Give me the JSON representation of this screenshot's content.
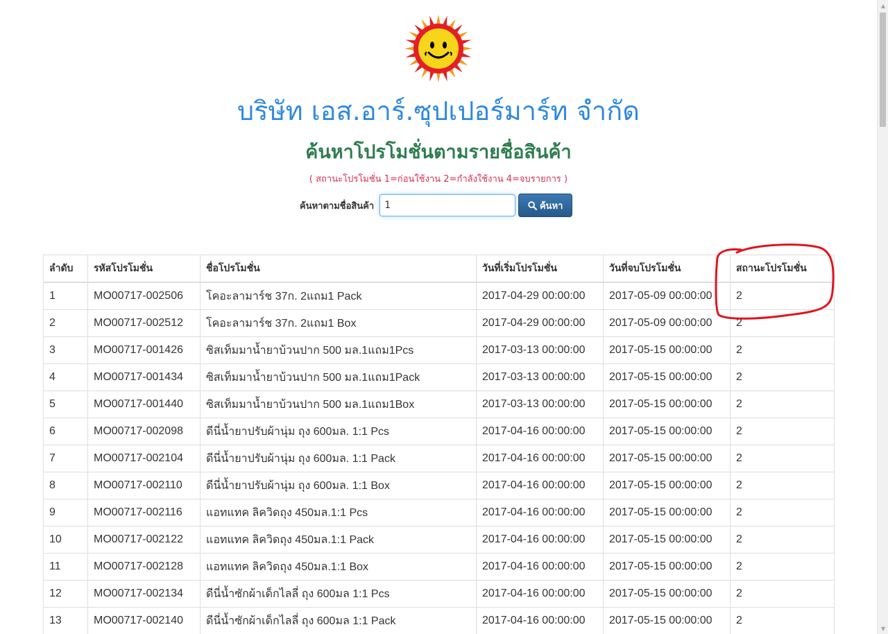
{
  "header": {
    "company_name": "บริษัท เอส.อาร์.ซุปเปอร์มาร์ท จำกัด",
    "page_title": "ค้นหาโปรโมชั่นตามรายชื่อสินค้า",
    "status_note": "( สถานะโปรโมชั่น 1=ก่อนใช้งาน 2=กำลังใช้งาน 4=จบรายการ )"
  },
  "search": {
    "label": "ค้นหาตามชื่อสินค้า",
    "value": "1",
    "button_label": "ค้นหา"
  },
  "table": {
    "columns": [
      "ลำดับ",
      "รหัสโปรโมชั่น",
      "ชื่อโปรโมชั่น",
      "วันที่เริ่มโปรโมชั่น",
      "วันที่จบโปรโมชั่น",
      "สถานะโปรโมชั่น"
    ],
    "rows": [
      [
        "1",
        "MO00717-002506",
        "โคอะลามาร์ช 37ก. 2แถม1 Pack",
        "2017-04-29 00:00:00",
        "2017-05-09 00:00:00",
        "2"
      ],
      [
        "2",
        "MO00717-002512",
        "โคอะลามาร์ช 37ก. 2แถม1 Box",
        "2017-04-29 00:00:00",
        "2017-05-09 00:00:00",
        "2"
      ],
      [
        "3",
        "MO00717-001426",
        "ซิสเท็มมาน้ำยาบ้วนปาก 500 มล.1แถม1Pcs",
        "2017-03-13 00:00:00",
        "2017-05-15 00:00:00",
        "2"
      ],
      [
        "4",
        "MO00717-001434",
        "ซิสเท็มมาน้ำยาบ้วนปาก 500 มล.1แถม1Pack",
        "2017-03-13 00:00:00",
        "2017-05-15 00:00:00",
        "2"
      ],
      [
        "5",
        "MO00717-001440",
        "ซิสเท็มมาน้ำยาบ้วนปาก 500 มล.1แถม1Box",
        "2017-03-13 00:00:00",
        "2017-05-15 00:00:00",
        "2"
      ],
      [
        "6",
        "MO00717-002098",
        "ดีนี่น้ำยาปรับผ้านุ่ม ถุง 600มล. 1:1 Pcs",
        "2017-04-16 00:00:00",
        "2017-05-15 00:00:00",
        "2"
      ],
      [
        "7",
        "MO00717-002104",
        "ดีนี่น้ำยาปรับผ้านุ่ม ถุง 600มล. 1:1 Pack",
        "2017-04-16 00:00:00",
        "2017-05-15 00:00:00",
        "2"
      ],
      [
        "8",
        "MO00717-002110",
        "ดีนี่น้ำยาปรับผ้านุ่ม ถุง 600มล. 1:1 Box",
        "2017-04-16 00:00:00",
        "2017-05-15 00:00:00",
        "2"
      ],
      [
        "9",
        "MO00717-002116",
        "แอทแทค ลิควิดถุง 450มล.1:1 Pcs",
        "2017-04-16 00:00:00",
        "2017-05-15 00:00:00",
        "2"
      ],
      [
        "10",
        "MO00717-002122",
        "แอทแทค ลิควิดถุง 450มล.1:1 Pack",
        "2017-04-16 00:00:00",
        "2017-05-15 00:00:00",
        "2"
      ],
      [
        "11",
        "MO00717-002128",
        "แอทแทค ลิควิดถุง 450มล.1:1 Box",
        "2017-04-16 00:00:00",
        "2017-05-15 00:00:00",
        "2"
      ],
      [
        "12",
        "MO00717-002134",
        "ดีนี่น้ำซักผ้าเด็กไลลี่ ถุง 600มล 1:1 Pcs",
        "2017-04-16 00:00:00",
        "2017-05-15 00:00:00",
        "2"
      ],
      [
        "13",
        "MO00717-002140",
        "ดีนี่น้ำซักผ้าเด็กไลลี่ ถุง 600มล 1:1 Pack",
        "2017-04-16 00:00:00",
        "2017-05-15 00:00:00",
        "2"
      ]
    ]
  },
  "icons": {
    "logo": "sun-logo-icon",
    "search": "search-icon",
    "annotation": "red-circle-annotation"
  },
  "colors": {
    "company": "#2f89e0",
    "title": "#2e7d4f",
    "note": "#d9304f",
    "button": "#265a88",
    "annotation": "#e0141e"
  }
}
